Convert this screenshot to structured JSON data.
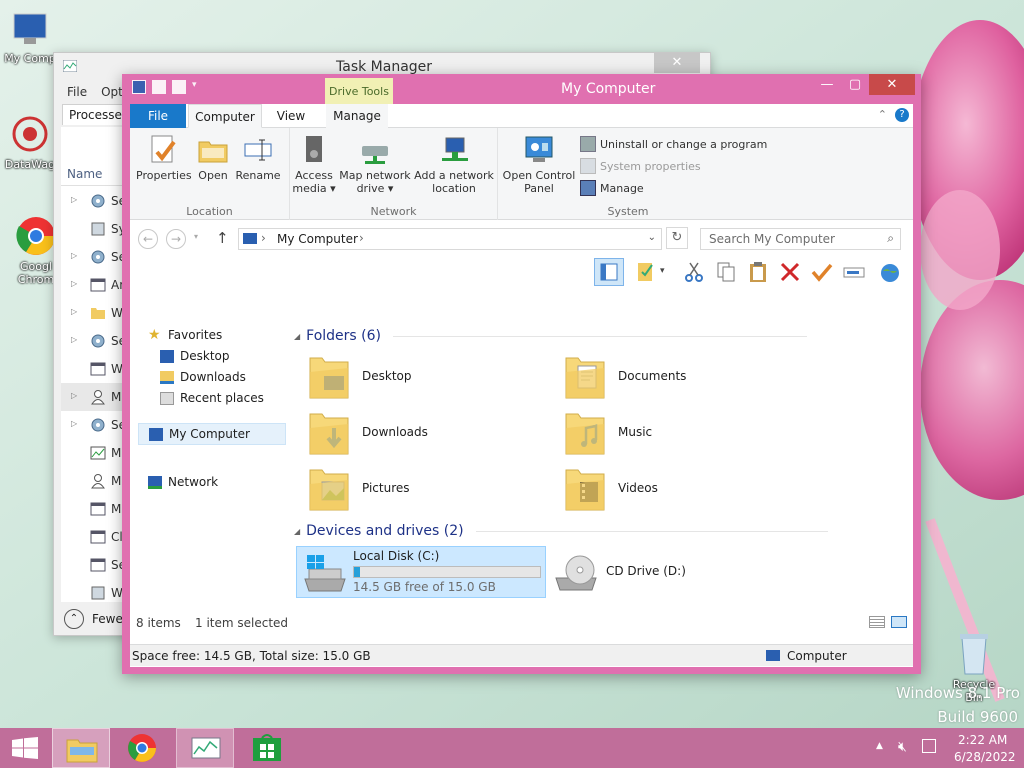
{
  "desktop": {
    "icons": [
      {
        "label": "My Comp"
      },
      {
        "label": "DataWag"
      },
      {
        "label": "Googl Chrom"
      },
      {
        "label": "Recycle Bin"
      }
    ],
    "watermark": {
      "line1": "Windows 8.1 Pro",
      "line2": "Build 9600"
    }
  },
  "task_manager": {
    "title": "Task Manager",
    "close_glyph": "✕",
    "menu": [
      "File",
      "Opti"
    ],
    "tab": "Processes",
    "column_name": "Name",
    "rows": [
      {
        "arrow": "▷",
        "icon": "gear-icon",
        "label": "Se"
      },
      {
        "arrow": "",
        "icon": "app-icon",
        "label": "Sy"
      },
      {
        "arrow": "▷",
        "icon": "gear-icon",
        "label": "Se"
      },
      {
        "arrow": "▷",
        "icon": "window-icon",
        "label": "An"
      },
      {
        "arrow": "▷",
        "icon": "folder-icon",
        "label": "W"
      },
      {
        "arrow": "▷",
        "icon": "gear-icon",
        "label": "Se"
      },
      {
        "arrow": "",
        "icon": "window-icon",
        "label": "W"
      },
      {
        "arrow": "▷",
        "icon": "user-icon",
        "label": "M"
      },
      {
        "arrow": "▷",
        "icon": "gear-icon",
        "label": "Se"
      },
      {
        "arrow": "",
        "icon": "chart-icon",
        "label": "M"
      },
      {
        "arrow": "",
        "icon": "user-icon",
        "label": "M"
      },
      {
        "arrow": "",
        "icon": "window-icon",
        "label": "M"
      },
      {
        "arrow": "",
        "icon": "window-icon",
        "label": "Cl"
      },
      {
        "arrow": "",
        "icon": "window-icon",
        "label": "Se"
      },
      {
        "arrow": "",
        "icon": "app-icon",
        "label": "W"
      }
    ],
    "fewer": "Fewe"
  },
  "explorer": {
    "title": "My Computer",
    "context_tab": "Drive Tools",
    "controls": {
      "minimize": "—",
      "maximize": "▢",
      "close": "✕"
    },
    "tabs": [
      "File",
      "Computer",
      "View",
      "Manage"
    ],
    "ribbon": {
      "location": {
        "label": "Location",
        "buttons": [
          "Properties",
          "Open",
          "Rename"
        ]
      },
      "network": {
        "label": "Network",
        "access_media": "Access media ▾",
        "map_drive": "Map network drive ▾",
        "add_location": "Add a network location"
      },
      "system": {
        "label": "System",
        "open_cp": "Open Control Panel",
        "uninstall": "Uninstall or change a program",
        "sys_props": "System properties",
        "manage": "Manage"
      }
    },
    "address": {
      "path": "My Computer",
      "separator": "›",
      "search_placeholder": "Search My Computer"
    },
    "nav": {
      "favorites": "Favorites",
      "desktop": "Desktop",
      "downloads": "Downloads",
      "recent": "Recent places",
      "computer": "My Computer",
      "network": "Network"
    },
    "folders_header": "Folders (6)",
    "folders": [
      {
        "name": "Desktop",
        "icon": "desktop-folder-icon"
      },
      {
        "name": "Documents",
        "icon": "documents-folder-icon"
      },
      {
        "name": "Downloads",
        "icon": "downloads-folder-icon"
      },
      {
        "name": "Music",
        "icon": "music-folder-icon"
      },
      {
        "name": "Pictures",
        "icon": "pictures-folder-icon"
      },
      {
        "name": "Videos",
        "icon": "videos-folder-icon"
      }
    ],
    "drives_header": "Devices and drives (2)",
    "drives": {
      "c": {
        "name": "Local Disk (C:)",
        "free": "14.5 GB free of 15.0 GB",
        "used_fraction": 0.033
      },
      "d": {
        "name": "CD Drive (D:)"
      }
    },
    "status": {
      "items": "8 items",
      "selected": "1 item selected",
      "space": "Space free: 14.5 GB, Total size: 15.0 GB",
      "location": "Computer"
    }
  },
  "taskbar": {
    "time": "2:22 AM",
    "date": "6/28/2022"
  },
  "colors": {
    "window_frame": "#e070b0",
    "file_tab": "#1979ca",
    "taskbar": "#c06e9a"
  }
}
